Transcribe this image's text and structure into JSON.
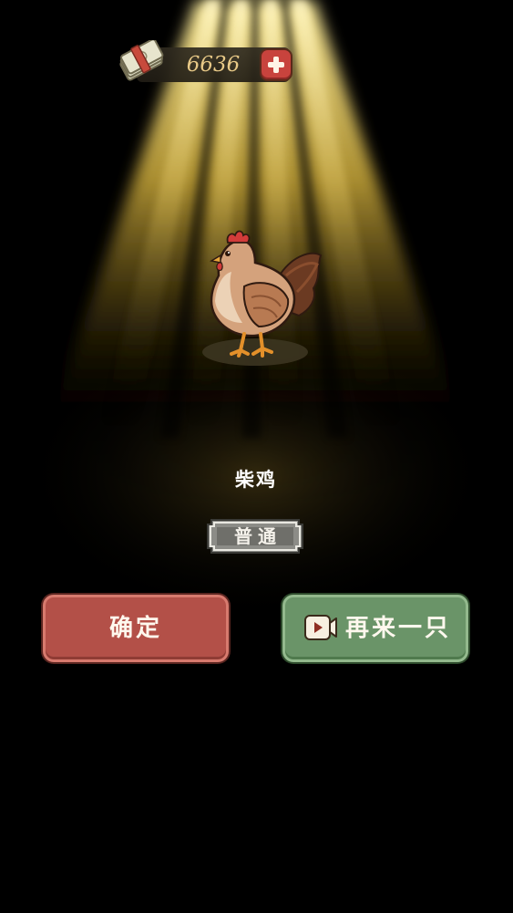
{
  "currency": {
    "value": "6636",
    "icon": "money-stack-icon",
    "add_icon": "plus-icon"
  },
  "reward": {
    "name": "柴鸡",
    "rarity": "普通",
    "image": "chicken"
  },
  "buttons": {
    "confirm_label": "确定",
    "again_label": "再来一只",
    "again_icon": "video-icon"
  },
  "colors": {
    "confirm": "#b35048",
    "again": "#6a9468",
    "add": "#c8433d",
    "spotlight": "#f0d050",
    "currency_text": "#e8c987"
  }
}
